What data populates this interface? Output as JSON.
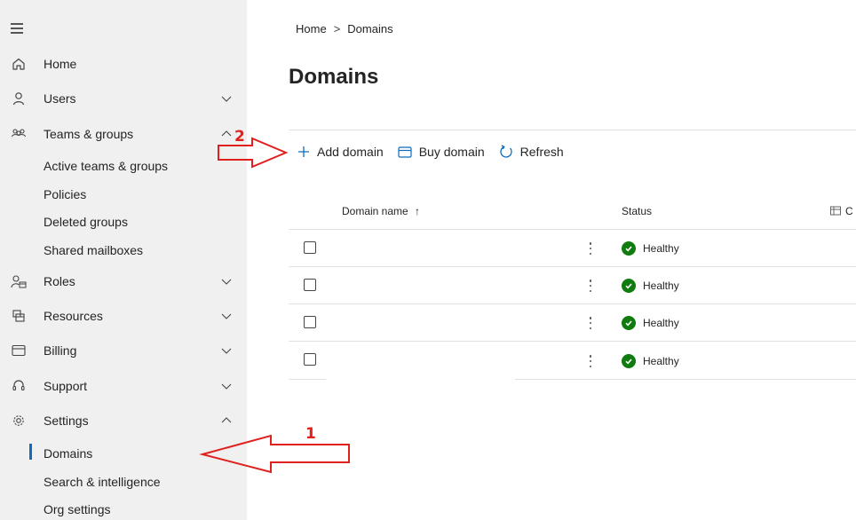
{
  "sidebar": {
    "items": [
      {
        "label": "Home",
        "icon": "home-icon"
      },
      {
        "label": "Users",
        "icon": "user-icon"
      },
      {
        "label": "Teams & groups",
        "icon": "people-team-icon"
      },
      {
        "label": "Roles",
        "icon": "role-icon"
      },
      {
        "label": "Resources",
        "icon": "resources-icon"
      },
      {
        "label": "Billing",
        "icon": "billing-card-icon"
      },
      {
        "label": "Support",
        "icon": "headset-icon"
      },
      {
        "label": "Settings",
        "icon": "gear-icon"
      }
    ],
    "teams_sub": [
      "Active teams & groups",
      "Policies",
      "Deleted groups",
      "Shared mailboxes"
    ],
    "settings_sub": [
      "Domains",
      "Search & intelligence",
      "Org settings"
    ]
  },
  "breadcrumb": {
    "home": "Home",
    "separator": ">",
    "current": "Domains"
  },
  "page": {
    "title": "Domains"
  },
  "toolbar": {
    "add_domain": "Add domain",
    "buy_domain": "Buy domain",
    "refresh": "Refresh"
  },
  "table": {
    "columns": {
      "domain_name": "Domain name",
      "sort_indicator": "↑",
      "status": "Status",
      "choose_columns": "C"
    },
    "rows": [
      {
        "domain": "",
        "status": "Healthy"
      },
      {
        "domain": "",
        "status": "Healthy"
      },
      {
        "domain": "",
        "status": "Healthy"
      },
      {
        "domain": "",
        "status": "Healthy"
      }
    ]
  },
  "annotations": {
    "step1": "1",
    "step2": "2"
  },
  "colors": {
    "accent": "#0f6cbd",
    "healthy": "#107c10",
    "annotation": "#e0201d",
    "sidebar_bg": "#f0f0f0"
  }
}
